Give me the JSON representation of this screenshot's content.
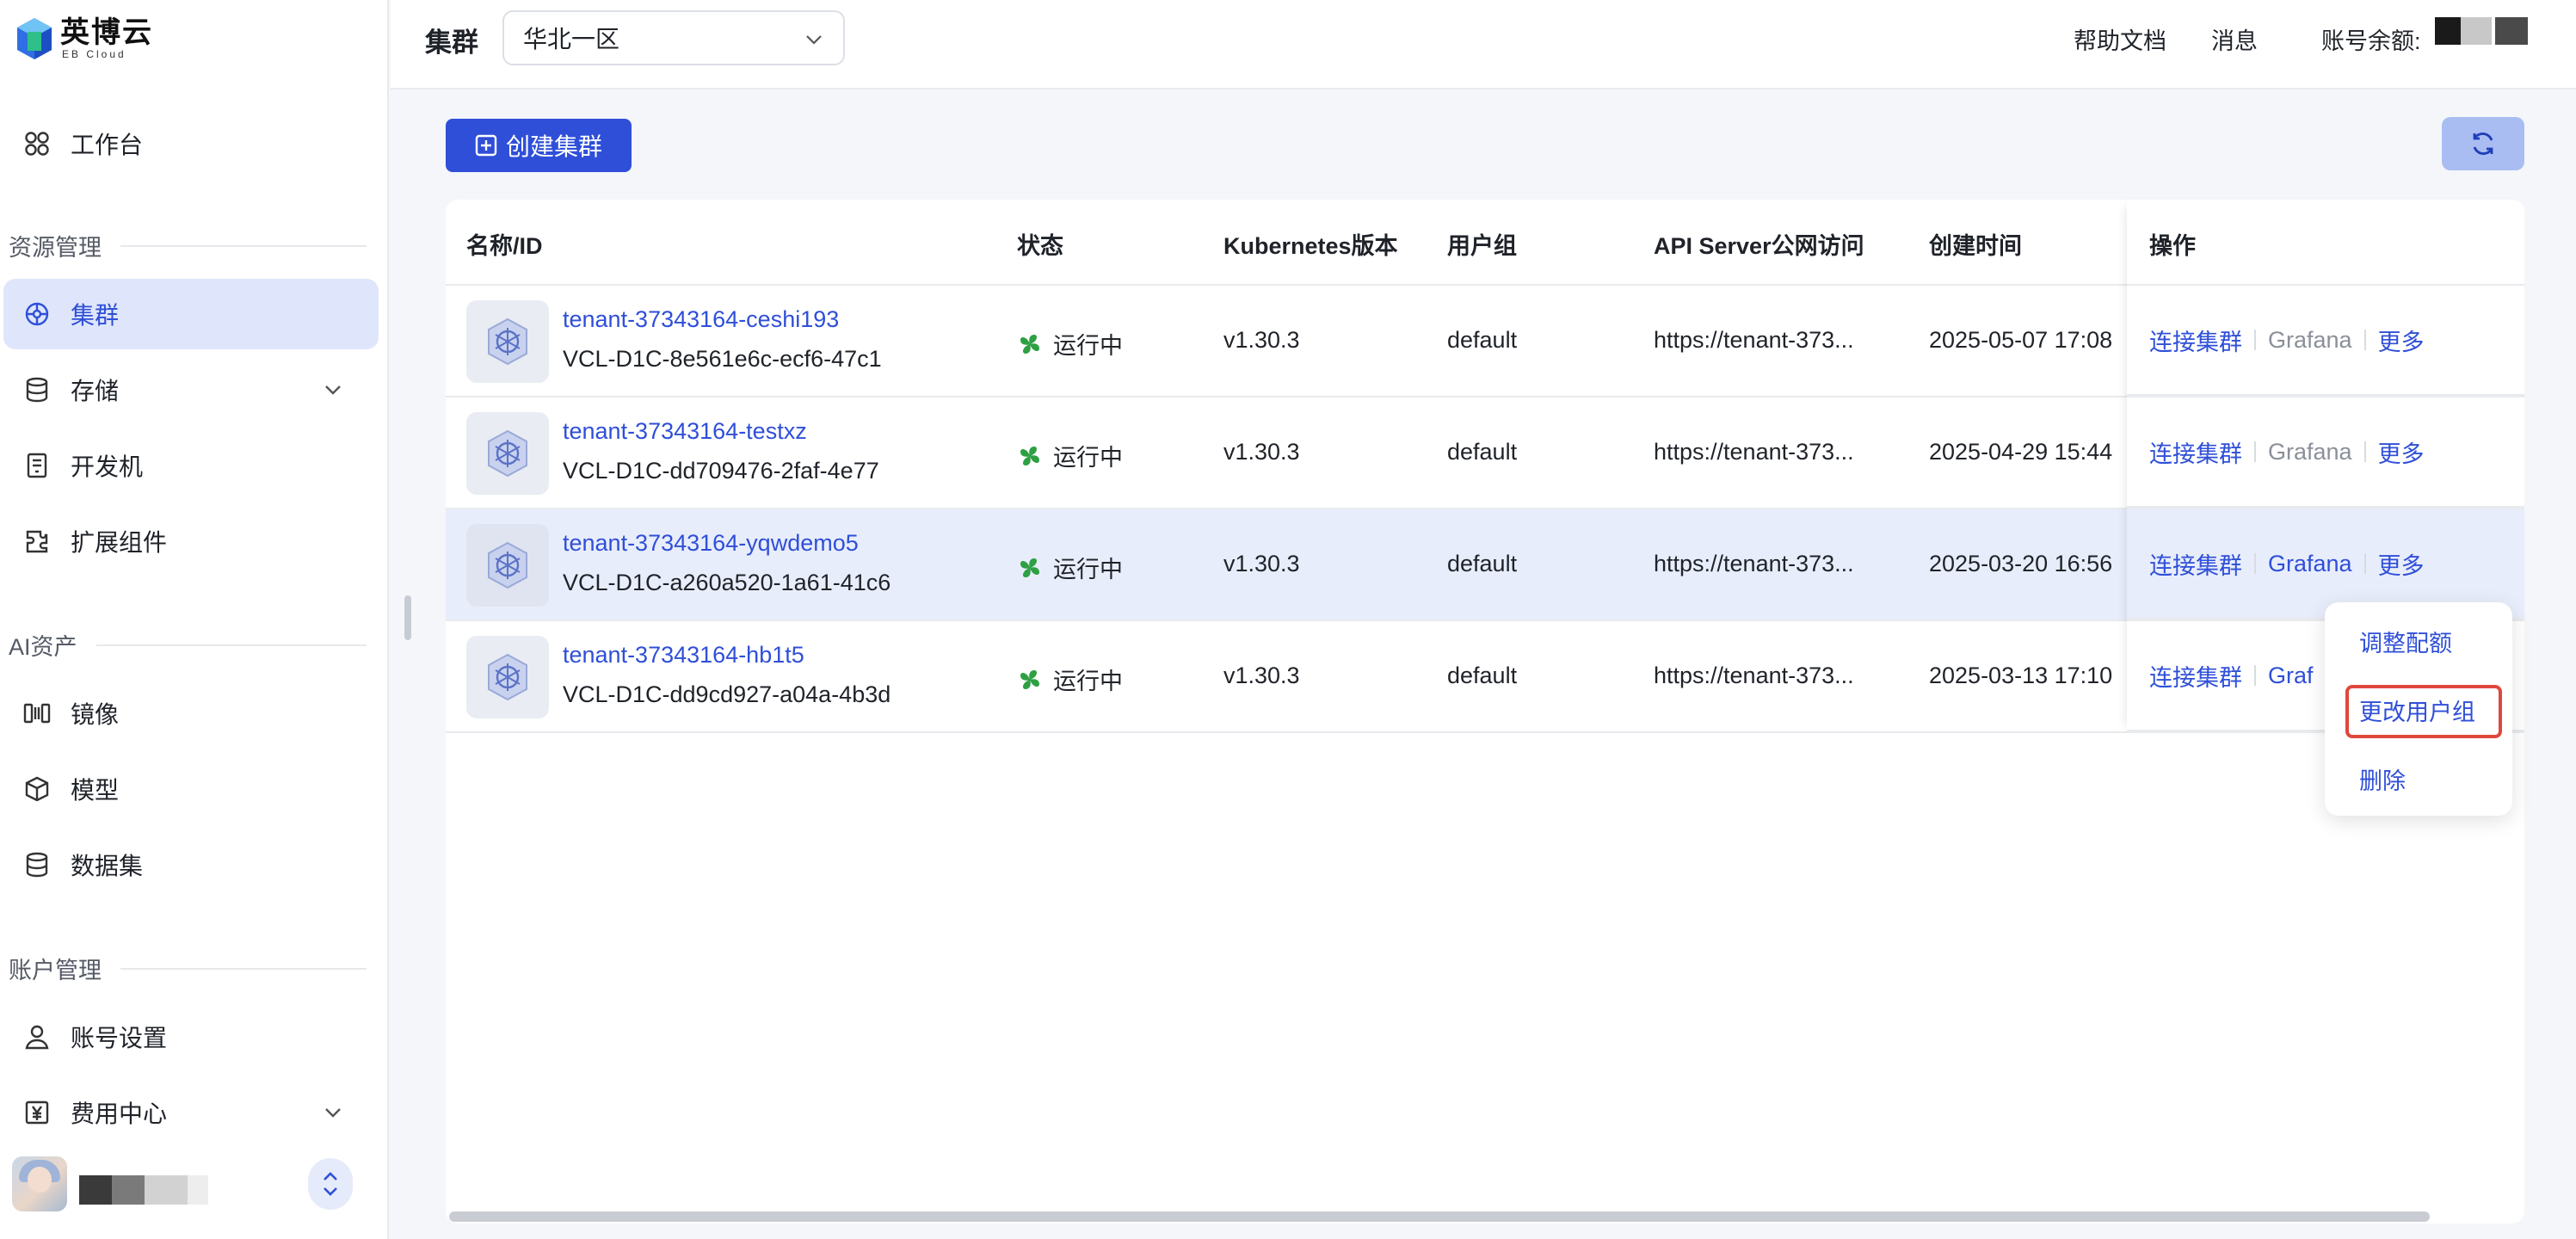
{
  "brand": {
    "name": "英博云",
    "sub": "EB Cloud"
  },
  "sidebar": {
    "items": [
      {
        "label": "工作台"
      },
      {
        "label": "集群"
      },
      {
        "label": "存储"
      },
      {
        "label": "开发机"
      },
      {
        "label": "扩展组件"
      },
      {
        "label": "镜像"
      },
      {
        "label": "模型"
      },
      {
        "label": "数据集"
      },
      {
        "label": "账号设置"
      },
      {
        "label": "费用中心"
      }
    ],
    "sections": {
      "resource": "资源管理",
      "ai": "AI资产",
      "account": "账户管理"
    }
  },
  "header": {
    "title": "集群",
    "region": "华北一区",
    "help": "帮助文档",
    "messages": "消息",
    "balance_label": "账号余额:"
  },
  "toolbar": {
    "create_label": "创建集群"
  },
  "table": {
    "columns": [
      "名称/ID",
      "状态",
      "Kubernetes版本",
      "用户组",
      "API Server公网访问",
      "创建时间",
      "操作"
    ],
    "rows": [
      {
        "name": "tenant-37343164-ceshi193",
        "id": "VCL-D1C-8e561e6c-ecf6-47c1",
        "status": "运行中",
        "version": "v1.30.3",
        "group": "default",
        "api": "https://tenant-373...",
        "created": "2025-05-07 17:08"
      },
      {
        "name": "tenant-37343164-testxz",
        "id": "VCL-D1C-dd709476-2faf-4e77",
        "status": "运行中",
        "version": "v1.30.3",
        "group": "default",
        "api": "https://tenant-373...",
        "created": "2025-04-29 15:44"
      },
      {
        "name": "tenant-37343164-yqwdemo5",
        "id": "VCL-D1C-a260a520-1a61-41c6",
        "status": "运行中",
        "version": "v1.30.3",
        "group": "default",
        "api": "https://tenant-373...",
        "created": "2025-03-20 16:56"
      },
      {
        "name": "tenant-37343164-hb1t5",
        "id": "VCL-D1C-dd9cd927-a04a-4b3d",
        "status": "运行中",
        "version": "v1.30.3",
        "group": "default",
        "api": "https://tenant-373...",
        "created": "2025-03-13 17:10"
      }
    ],
    "actions": {
      "connect": "连接集群",
      "grafana": "Grafana",
      "grafana_partial": "Graf",
      "more": "更多"
    }
  },
  "dropdown": {
    "items": [
      "调整配额",
      "更改用户组",
      "删除"
    ]
  },
  "colors": {
    "accent": "#2f4fd8",
    "active_bg": "#dfe6fb",
    "status_green": "#2ea043",
    "highlight_border": "#e0473c"
  }
}
